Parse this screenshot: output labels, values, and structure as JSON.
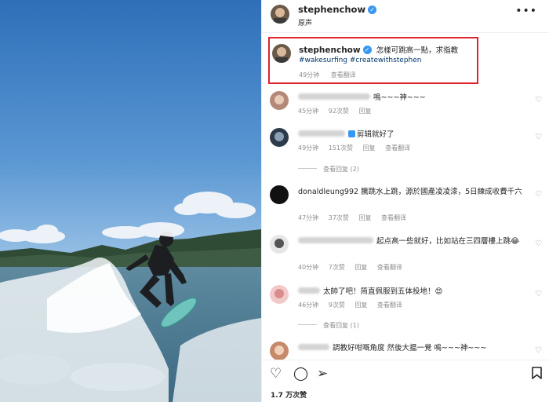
{
  "post": {
    "username": "stephenchow",
    "verified_icon": "verified-badge-icon",
    "subtitle": "原声",
    "more_icon": "more-horizontal-icon"
  },
  "caption": {
    "username": "stephenchow",
    "text": "怎樣可跳高一點，求指教",
    "hashtags": "#wakesurfing #createwithstephen",
    "time": "49分钟",
    "translate": "查看翻译"
  },
  "comments": [
    {
      "text": "嗚~~~神~~~",
      "time": "45分钟",
      "likes": "92次赞",
      "reply": "回复",
      "translate": ""
    },
    {
      "text": "剪辑就好了",
      "time": "49分钟",
      "likes": "151次赞",
      "reply": "回复",
      "translate": "查看翻译",
      "replies": "查看回复 (2)"
    },
    {
      "text": "donaldleung992 騰跳水上跳，源於國產凌凌漆，5日練成收費千六",
      "time": "47分钟",
      "likes": "37次赞",
      "reply": "回复",
      "translate": "查看翻译"
    },
    {
      "text": "起点高一些就好，比如站在三四層樓上跳😂",
      "time": "40分钟",
      "likes": "7次赞",
      "reply": "回复",
      "translate": "查看翻译"
    },
    {
      "text": "太帥了吧！简直佩服到五体投地！😍",
      "time": "46分钟",
      "likes": "9次赞",
      "reply": "回复",
      "translate": "查看翻译",
      "replies": "查看回复 (1)"
    },
    {
      "text": "調教好咁嘅角度 然後大揾一覺 嗚~~~神~~~",
      "time": "",
      "likes": "",
      "reply": "",
      "translate": ""
    }
  ],
  "actions": {
    "like_icon": "heart-icon",
    "comment_icon": "comment-icon",
    "share_icon": "send-icon",
    "save_icon": "bookmark-icon",
    "likes_count": "1.7 万次赞"
  },
  "colors": {
    "accent_blue": "#3897f0",
    "highlight_border": "#e0242f",
    "hashtag": "#00376b",
    "muted": "#8e8e8e"
  }
}
